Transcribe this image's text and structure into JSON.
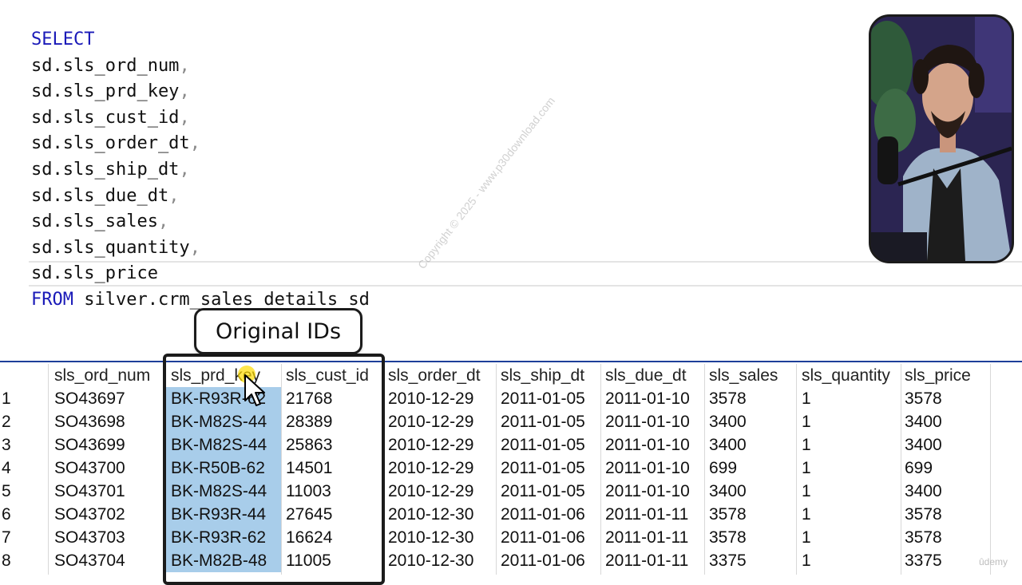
{
  "editor": {
    "lines": [
      {
        "kw": "SELECT",
        "text": "",
        "comma": ""
      },
      {
        "kw": "",
        "text": "sd.sls_ord_num",
        "comma": ","
      },
      {
        "kw": "",
        "text": "sd.sls_prd_key",
        "comma": ","
      },
      {
        "kw": "",
        "text": "sd.sls_cust_id",
        "comma": ","
      },
      {
        "kw": "",
        "text": "sd.sls_order_dt",
        "comma": ","
      },
      {
        "kw": "",
        "text": "sd.sls_ship_dt",
        "comma": ","
      },
      {
        "kw": "",
        "text": "sd.sls_due_dt",
        "comma": ","
      },
      {
        "kw": "",
        "text": "sd.sls_sales",
        "comma": ","
      },
      {
        "kw": "",
        "text": "sd.sls_quantity",
        "comma": ","
      },
      {
        "kw": "",
        "text": "sd.sls_price",
        "comma": ""
      },
      {
        "kw": "FROM",
        "text": " silver.crm_sales_details sd",
        "comma": ""
      }
    ]
  },
  "callout": {
    "text": "Original IDs"
  },
  "watermark": {
    "text": "Copyright © 2025 - www.p30download.com"
  },
  "logo": {
    "text": "ûdemy"
  },
  "results": {
    "columns": [
      "",
      "sls_ord_num",
      "sls_prd_key",
      "sls_cust_id",
      "sls_order_dt",
      "sls_ship_dt",
      "sls_due_dt",
      "sls_sales",
      "sls_quantity",
      "sls_price"
    ],
    "rows": [
      [
        "1",
        "SO43697",
        "BK-R93R-62",
        "21768",
        "2010-12-29",
        "2011-01-05",
        "2011-01-10",
        "3578",
        "1",
        "3578"
      ],
      [
        "2",
        "SO43698",
        "BK-M82S-44",
        "28389",
        "2010-12-29",
        "2011-01-05",
        "2011-01-10",
        "3400",
        "1",
        "3400"
      ],
      [
        "3",
        "SO43699",
        "BK-M82S-44",
        "25863",
        "2010-12-29",
        "2011-01-05",
        "2011-01-10",
        "3400",
        "1",
        "3400"
      ],
      [
        "4",
        "SO43700",
        "BK-R50B-62",
        "14501",
        "2010-12-29",
        "2011-01-05",
        "2011-01-10",
        "699",
        "1",
        "699"
      ],
      [
        "5",
        "SO43701",
        "BK-M82S-44",
        "11003",
        "2010-12-29",
        "2011-01-05",
        "2011-01-10",
        "3400",
        "1",
        "3400"
      ],
      [
        "6",
        "SO43702",
        "BK-R93R-44",
        "27645",
        "2010-12-30",
        "2011-01-06",
        "2011-01-11",
        "3578",
        "1",
        "3578"
      ],
      [
        "7",
        "SO43703",
        "BK-R93R-62",
        "16624",
        "2010-12-30",
        "2011-01-06",
        "2011-01-11",
        "3578",
        "1",
        "3578"
      ],
      [
        "8",
        "SO43704",
        "BK-M82B-48",
        "11005",
        "2010-12-30",
        "2011-01-06",
        "2011-01-11",
        "3375",
        "1",
        "3375"
      ]
    ]
  },
  "colors": {
    "keyword": "#1a1ab8",
    "selection": "#a8cdea",
    "grid_divider": "#1d3f99",
    "highlight_border": "#1b1b1b"
  }
}
